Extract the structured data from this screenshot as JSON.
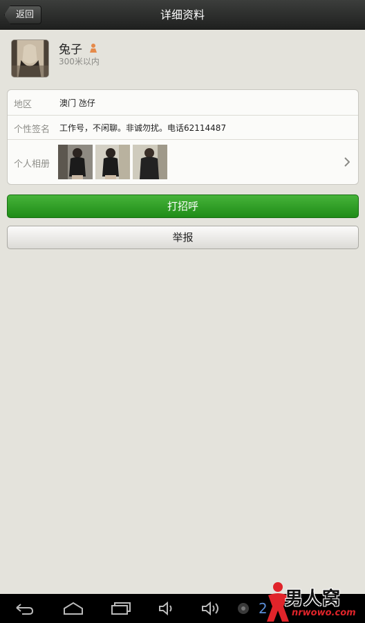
{
  "header": {
    "back_label": "返回",
    "title": "详细资料"
  },
  "profile": {
    "name": "兔子",
    "distance": "300米以内",
    "gender_icon": "female-icon",
    "gender_color": "#e58a4a"
  },
  "info": {
    "region_label": "地区",
    "region_value": "澳门 氹仔",
    "signature_label": "个性签名",
    "signature_value": "工作号，不闲聊。非诚勿扰。电话62114487",
    "album_label": "个人相册",
    "album_photo_count": 3
  },
  "actions": {
    "greet_label": "打招呼",
    "report_label": "举报",
    "greet_color": "#2fa024"
  },
  "navbar": {
    "icons": [
      "back-icon",
      "home-icon",
      "recent-apps-icon",
      "volume-down-icon",
      "volume-up-icon",
      "camera-icon"
    ],
    "clock_fragment": "2"
  },
  "watermark": {
    "brand": "男人窝",
    "url": "nrwowo.com"
  }
}
